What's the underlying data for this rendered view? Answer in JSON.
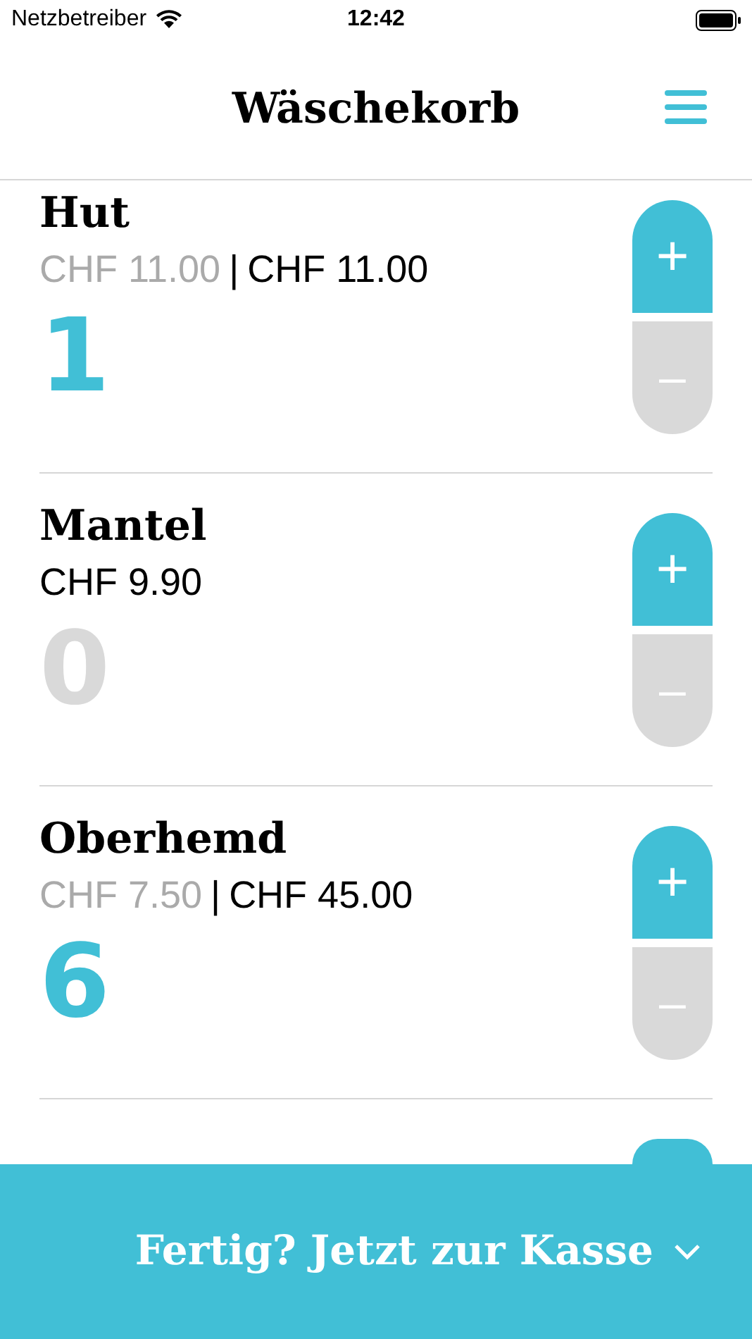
{
  "status_bar": {
    "carrier": "Netzbetreiber",
    "time": "12:42"
  },
  "header": {
    "title": "Wäschekorb"
  },
  "items": [
    {
      "name": "Hut",
      "unit_price": "CHF 11.00",
      "separator": "|",
      "total": "CHF 11.00",
      "quantity": "1",
      "in_basket": true,
      "plus": "+",
      "minus": "–"
    },
    {
      "name": "Mantel",
      "unit_price": "CHF 9.90",
      "quantity": "0",
      "in_basket": false,
      "plus": "+",
      "minus": "–"
    },
    {
      "name": "Oberhemd",
      "unit_price": "CHF 7.50",
      "separator": "|",
      "total": "CHF 45.00",
      "quantity": "6",
      "in_basket": true,
      "plus": "+",
      "minus": "–"
    }
  ],
  "more_items_below": true,
  "checkout": {
    "label": "Fertig? Jetzt zur Kasse"
  }
}
